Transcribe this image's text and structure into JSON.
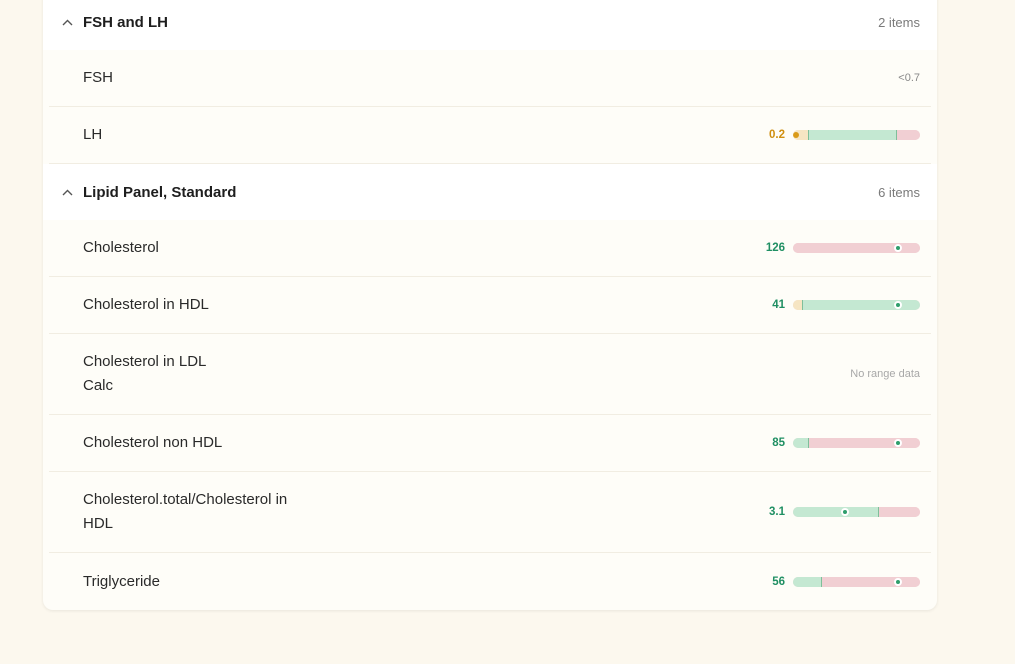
{
  "groups": [
    {
      "title": "FSH and LH",
      "count": "2 items",
      "rows": [
        {
          "name": "FSH",
          "value": "<0.7"
        },
        {
          "name": "LH",
          "value": "0.2"
        }
      ]
    },
    {
      "title": "Lipid Panel, Standard",
      "count": "6 items",
      "rows": [
        {
          "name": "Cholesterol",
          "value": "126"
        },
        {
          "name": "Cholesterol in HDL",
          "value": "41"
        },
        {
          "name": "Cholesterol in LDL Calc",
          "value": "No range data"
        },
        {
          "name": "Cholesterol non HDL",
          "value": "85"
        },
        {
          "name": "Cholesterol.total/Cholesterol in HDL",
          "value": "3.1"
        },
        {
          "name": "Triglyceride",
          "value": "56"
        }
      ]
    }
  ],
  "range_bars": {
    "LH": {
      "status": "low",
      "marker_fraction": 0.02,
      "low_end": 0.12,
      "normal_end": 0.81
    },
    "Cholesterol": {
      "status": "normal",
      "marker_fraction": 0.83,
      "low_end": 0.0,
      "normal_end": 0.0
    },
    "Cholesterol in HDL": {
      "status": "normal",
      "marker_fraction": 0.83,
      "low_end": 0.07,
      "normal_end": 1.0
    },
    "Cholesterol non HDL": {
      "status": "normal",
      "marker_fraction": 0.83,
      "low_end": 0.0,
      "normal_end": 0.12
    },
    "Cholesterol.total/Cholesterol in HDL": {
      "status": "normal",
      "marker_fraction": 0.41,
      "low_end": 0.0,
      "normal_end": 0.67
    },
    "Triglyceride": {
      "status": "normal",
      "marker_fraction": 0.83,
      "low_end": 0.0,
      "normal_end": 0.22
    }
  },
  "colors": {
    "background": "#fcf8ee",
    "in_range": "#1f8f63",
    "low": "#d08f10",
    "normal_band": "#c4e8d2",
    "high_band": "#f1cfd3",
    "low_band": "#f6e5c3"
  }
}
